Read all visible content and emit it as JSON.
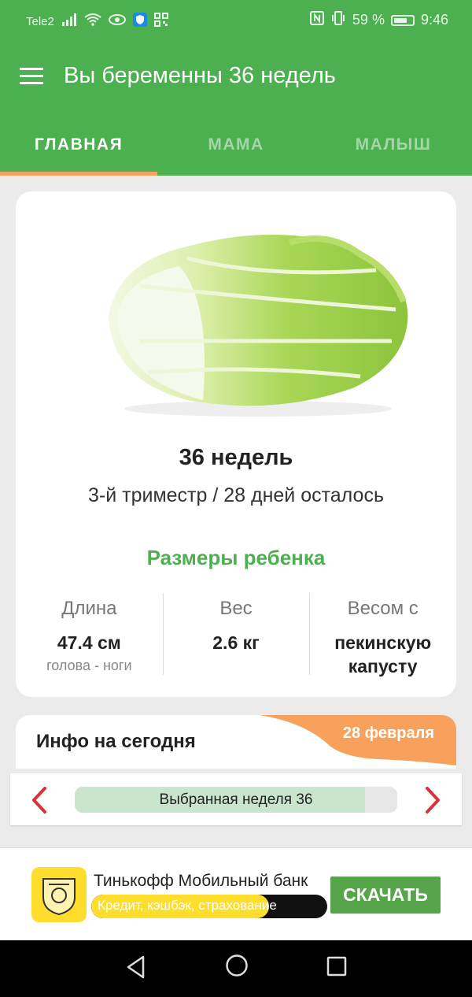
{
  "status_bar": {
    "carrier": "Tele2",
    "battery": "59 %",
    "time": "9:46"
  },
  "toolbar": {
    "title": "Вы беременны 36 недель"
  },
  "tabs": [
    {
      "label": "ГЛАВНАЯ",
      "active": true
    },
    {
      "label": "МАМА",
      "active": false
    },
    {
      "label": "МАЛЫШ",
      "active": false
    }
  ],
  "week_card": {
    "week_title": "36 недель",
    "trimester_text": "3-й триместр / 28 дней осталось",
    "sizes_title": "Размеры ребенка",
    "stats": [
      {
        "label": "Длина",
        "value": "47.4 см",
        "sub": "голова - ноги"
      },
      {
        "label": "Вес",
        "value": "2.6 кг",
        "sub": ""
      },
      {
        "label": "Весом с",
        "value_line1": "пекинскую",
        "value_line2": "капусту"
      }
    ]
  },
  "info": {
    "title": "Инфо на сегодня",
    "date": "28 февраля"
  },
  "week_selector": {
    "label": "Выбранная неделя 36",
    "progress": 0.9
  },
  "ad": {
    "title": "Тинькофф Мобильный банк",
    "subtitle": "Кредит, кэшбэк, страхование",
    "button": "СКАЧАТЬ"
  },
  "colors": {
    "primary": "#4caf50",
    "accent": "#f7a15c",
    "arrow": "#d9343a",
    "ad_yellow": "#ffdd2d",
    "ad_button": "#56a54a"
  }
}
